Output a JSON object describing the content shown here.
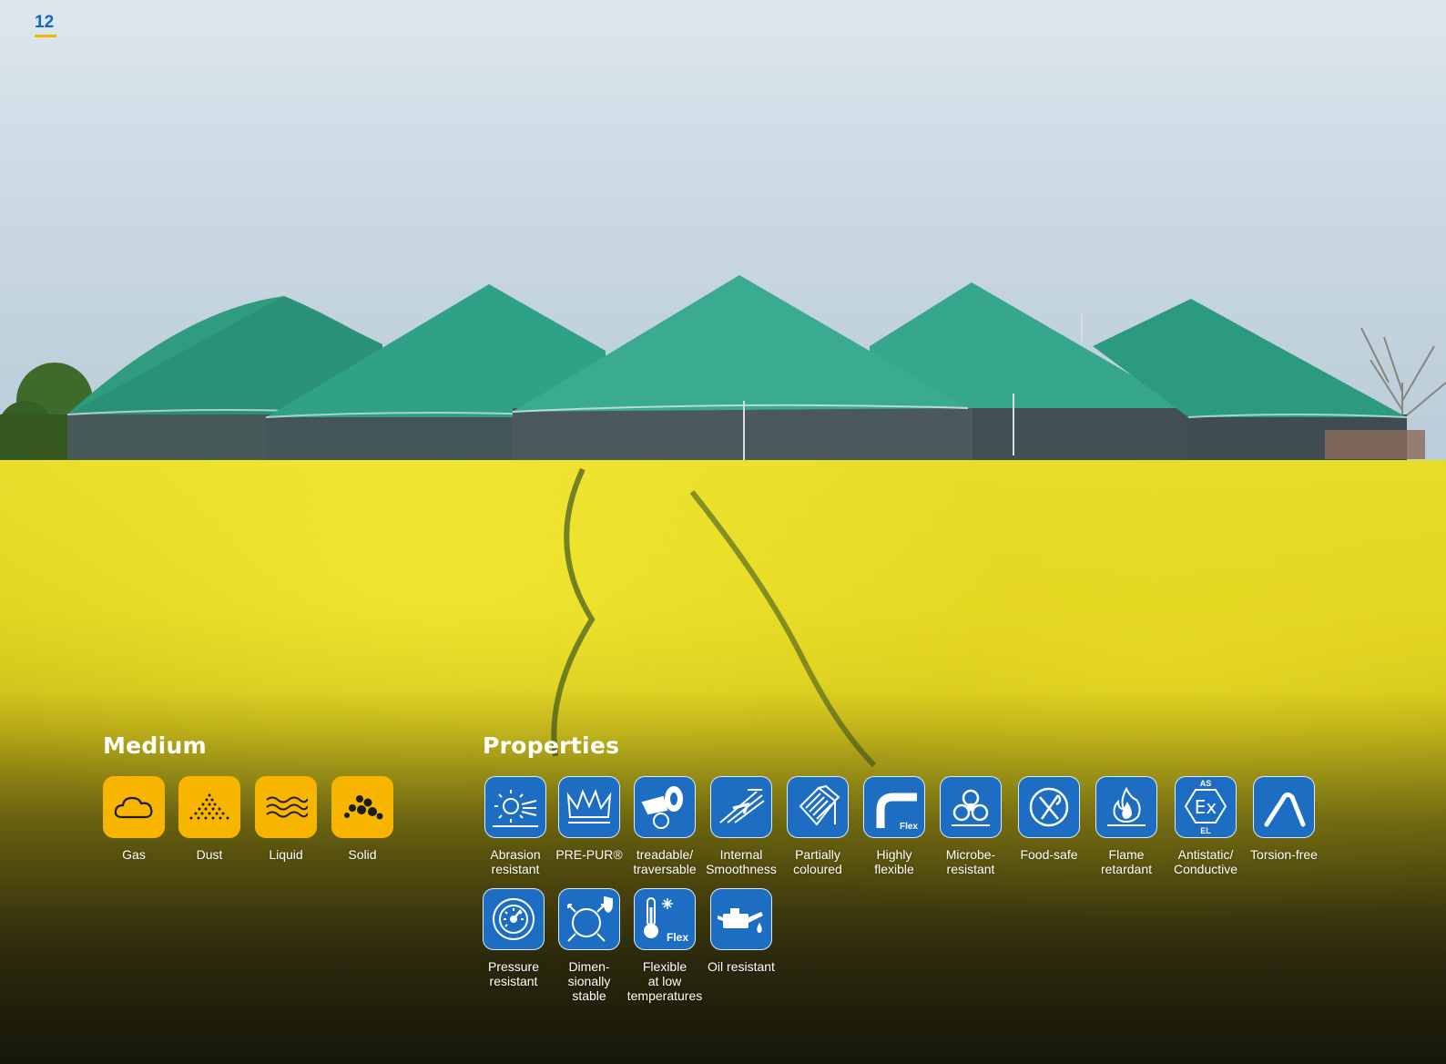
{
  "page_number": "12",
  "colors": {
    "page_number": "#1565c0",
    "accent_bar": "#f5b400",
    "medium_tile": "#f7b500",
    "property_tile": "#1d6ec2",
    "text": "#ffffff"
  },
  "medium": {
    "title": "Medium",
    "items": [
      {
        "label": "Gas",
        "icon": "cloud-icon"
      },
      {
        "label": "Dust",
        "icon": "dust-icon"
      },
      {
        "label": "Liquid",
        "icon": "waves-icon"
      },
      {
        "label": "Solid",
        "icon": "rocks-icon"
      }
    ]
  },
  "properties": {
    "title": "Properties",
    "items": [
      {
        "label": "Abrasion\nresistant",
        "icon": "abrasion-icon"
      },
      {
        "label": "PRE-PUR®",
        "icon": "crown-icon"
      },
      {
        "label": "treadable/\ntraversable",
        "icon": "tire-icon"
      },
      {
        "label": "Internal\nSmoothness",
        "icon": "smoothness-icon"
      },
      {
        "label": "Partially\ncoloured",
        "icon": "coloured-hose-icon"
      },
      {
        "label": "Highly\nflexible",
        "icon": "flex-bend-icon",
        "tag": "Flex"
      },
      {
        "label": "Microbe-\nresistant",
        "icon": "biohazard-icon"
      },
      {
        "label": "Food-safe",
        "icon": "cutlery-icon"
      },
      {
        "label": "Flame\nretardant",
        "icon": "flame-icon"
      },
      {
        "label": "Antistatic/\nConductive",
        "icon": "ex-icon",
        "top": "AS",
        "bottom": "EL",
        "mark": "Ex"
      },
      {
        "label": "Torsion-free",
        "icon": "torsion-icon"
      },
      {
        "label": "Pressure\nresistant",
        "icon": "gauge-icon"
      },
      {
        "label": "Dimen-\nsionally\nstable",
        "icon": "dimension-icon"
      },
      {
        "label": "Flexible\nat low\ntemperatures",
        "icon": "thermometer-icon",
        "tag": "Flex"
      },
      {
        "label": "Oil resistant",
        "icon": "oil-can-icon"
      }
    ]
  }
}
